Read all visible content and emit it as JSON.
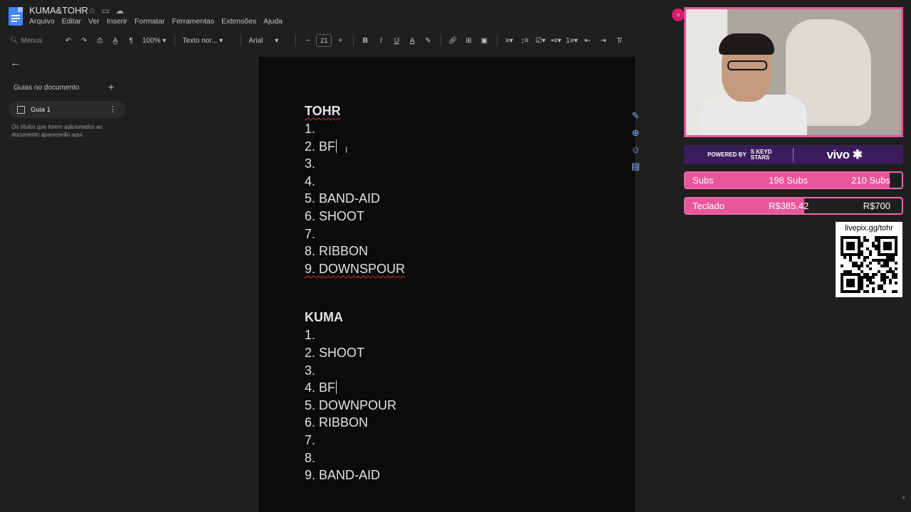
{
  "document": {
    "title": "KUMA&TOHR",
    "menu": [
      "Arquivo",
      "Editar",
      "Ver",
      "Inserir",
      "Formatar",
      "Ferramentas",
      "Extensões",
      "Ajuda"
    ]
  },
  "toolbar": {
    "search_placeholder": "Menus",
    "zoom": "100%",
    "style": "Texto nor...",
    "font": "Arial",
    "font_size": "21"
  },
  "outline": {
    "title": "Guias no documento",
    "tab_name": "Guia 1",
    "hint": "Os títulos que forem adicionados ao documento aparecerão aqui."
  },
  "content": {
    "sections": [
      {
        "heading": "TOHR",
        "items": [
          "1.",
          "2. BF",
          "3.",
          "4.",
          "5. BAND-AID",
          "6. SHOOT",
          "7.",
          "8. RIBBON",
          "9. DOWNSPOUR"
        ]
      },
      {
        "heading": "KUMA",
        "items": [
          "1.",
          "2. SHOOT",
          "3.",
          "4. BF",
          "5. DOWNPOUR",
          "6. RIBBON",
          "7.",
          "8.",
          "9. BAND-AID"
        ]
      }
    ]
  },
  "overlay": {
    "sponsor_powered_by": "POWERED BY",
    "sponsor_brand_line1": "S KEYD",
    "sponsor_brand_line2": "STARS",
    "sponsor_vivo": "vivo",
    "goals": [
      {
        "label": "Subs",
        "current": "198 Subs",
        "target": "210 Subs",
        "progress": 0.943
      },
      {
        "label": "Teclado",
        "current": "R$385,42",
        "target": "R$700",
        "progress": 0.55
      }
    ],
    "qr_label": "livepix.gg/tohr"
  },
  "colors": {
    "accent_pink": "#e8569b",
    "sponsor_purple": "#3b1d5e",
    "spellcheck_red": "#d93025",
    "docs_blue": "#4285f4"
  }
}
